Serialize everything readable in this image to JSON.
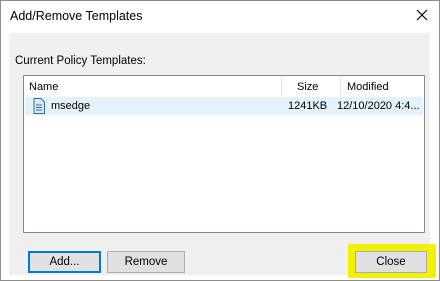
{
  "window": {
    "title": "Add/Remove Templates"
  },
  "section": {
    "label": "Current Policy Templates:"
  },
  "list": {
    "columns": [
      "Name",
      "Size",
      "Modified"
    ],
    "rows": [
      {
        "name": "msedge",
        "size": "1241KB",
        "modified": "12/10/2020 4:4..."
      }
    ]
  },
  "buttons": {
    "add": "Add...",
    "remove": "Remove",
    "close": "Close"
  },
  "colors": {
    "highlight": "#f2f200",
    "selection": "#e5f1fb",
    "focus": "#0078d7"
  },
  "icons": {
    "close": "close-icon",
    "file": "adm-file-icon"
  }
}
